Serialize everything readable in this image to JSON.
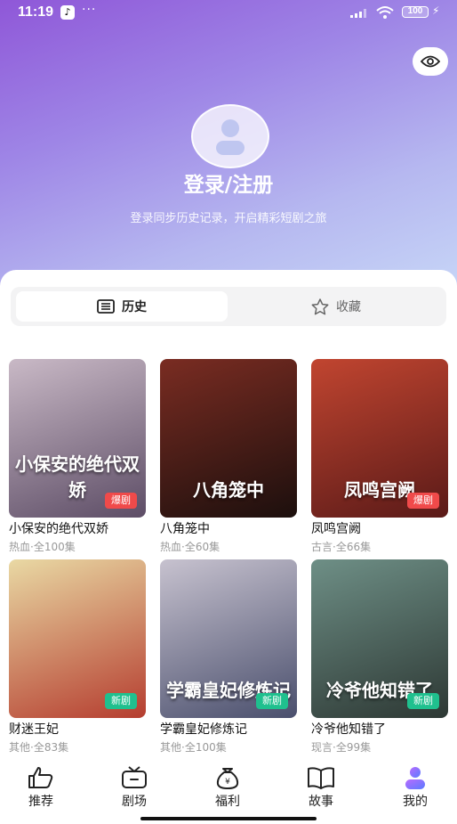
{
  "status_bar": {
    "time": "11:19",
    "more": "···",
    "battery": "100"
  },
  "header": {
    "login_title": "登录/注册",
    "login_subtitle": "登录同步历史记录，开启精彩短剧之旅"
  },
  "tabs": [
    {
      "label": "历史",
      "icon": "list-icon",
      "active": true
    },
    {
      "label": "收藏",
      "icon": "star-icon",
      "active": false
    }
  ],
  "dramas": [
    {
      "title": "小保安的绝代双娇",
      "meta": "热血·全100集",
      "badge": "爆剧",
      "badge_type": "hot",
      "poster_text": "小保安的绝代双娇",
      "color1": "#c9b9c6",
      "color2": "#5d4d66"
    },
    {
      "title": "八角笼中",
      "meta": "热血·全60集",
      "badge": "",
      "badge_type": "",
      "poster_text": "八角笼中",
      "color1": "#7a2c22",
      "color2": "#1c0f0d"
    },
    {
      "title": "凤鸣宫阙",
      "meta": "古言·全66集",
      "badge": "爆剧",
      "badge_type": "hot",
      "poster_text": "凤鸣宫阙",
      "color1": "#c14530",
      "color2": "#5a1a18"
    },
    {
      "title": "财迷王妃",
      "meta": "其他·全83集",
      "badge": "新剧",
      "badge_type": "new",
      "poster_text": "",
      "color1": "#e9d9a4",
      "color2": "#b53d2f"
    },
    {
      "title": "学霸皇妃修炼记",
      "meta": "其他·全100集",
      "badge": "新剧",
      "badge_type": "new",
      "poster_text": "学霸皇妃修炼记",
      "color1": "#c7c2cf",
      "color2": "#4a4f6d"
    },
    {
      "title": "冷爷他知错了",
      "meta": "现言·全99集",
      "badge": "新剧",
      "badge_type": "new",
      "poster_text": "冷爷他知错了",
      "color1": "#6e8f86",
      "color2": "#2d3834"
    }
  ],
  "bottom_nav": [
    {
      "label": "推荐",
      "icon": "thumbs-up-icon",
      "active": false
    },
    {
      "label": "剧场",
      "icon": "tv-icon",
      "active": false
    },
    {
      "label": "福利",
      "icon": "money-bag-icon",
      "active": false
    },
    {
      "label": "故事",
      "icon": "book-icon",
      "active": false
    },
    {
      "label": "我的",
      "icon": "profile-icon",
      "active": true
    }
  ],
  "colors": {
    "accent": "#8f57d8",
    "hot_badge": "#f04a4a",
    "new_badge": "#1fc08e"
  }
}
